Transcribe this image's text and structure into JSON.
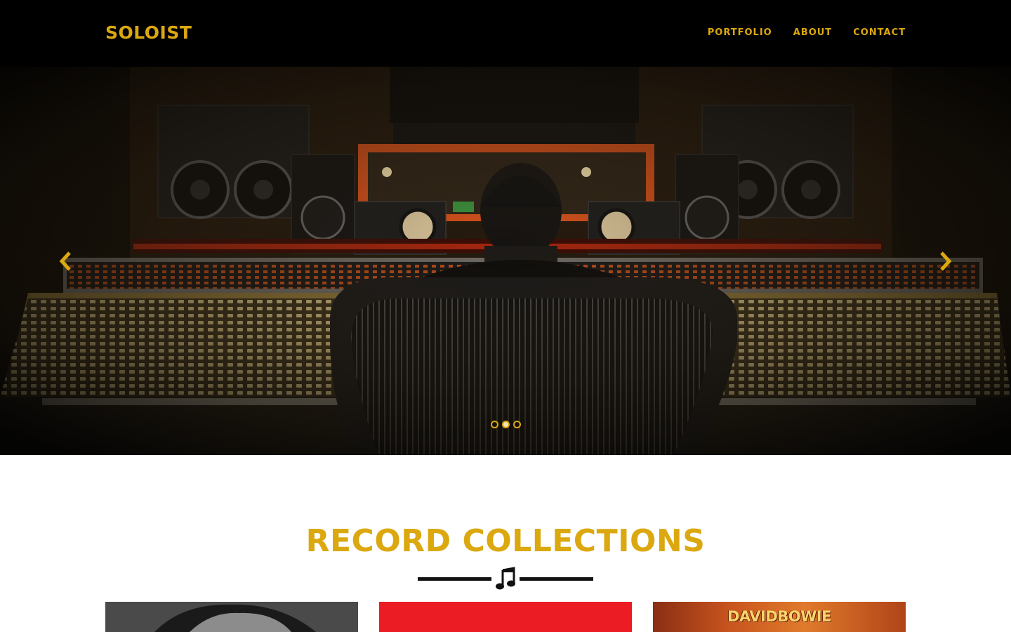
{
  "site": {
    "logo": "SOLOIST",
    "nav": [
      "PORTFOLIO",
      "ABOUT",
      "CONTACT"
    ]
  },
  "hero": {
    "slide_count": 3,
    "active_slide": 2,
    "prev_icon": "chevron-left-icon",
    "next_icon": "chevron-right-icon"
  },
  "collections": {
    "title": "RECORD COLLECTIONS",
    "divider_icon": "music-note-icon",
    "albums": [
      {
        "cover_text": ""
      },
      {
        "cover_text": ""
      },
      {
        "cover_text": "DAVIDBOWIE"
      }
    ]
  },
  "colors": {
    "accent": "#dba80f",
    "header_bg": "#000000",
    "album_red": "#ec1c24"
  }
}
